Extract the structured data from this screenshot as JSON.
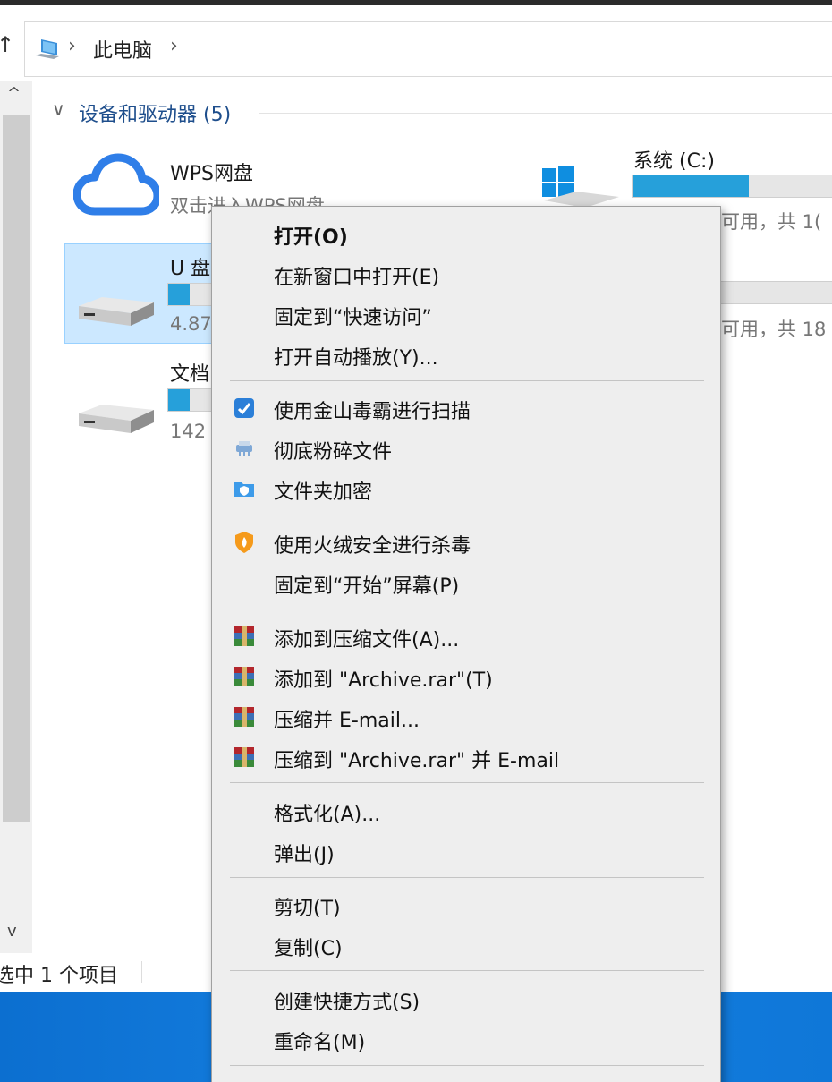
{
  "address": {
    "segment": "此电脑"
  },
  "group": {
    "title": "设备和驱动器 (5)"
  },
  "drives": [
    {
      "name": "WPS网盘",
      "sub": "双击进入WPS网盘",
      "fill": 0
    },
    {
      "name": "系统 (C:)",
      "sub": "可用，共 1(",
      "fill": 0.54
    },
    {
      "name": "U 盘",
      "sub": "4.87",
      "fill": 0.27
    },
    {
      "name": "",
      "sub": "可用，共 18",
      "fill": 0.3
    },
    {
      "name": "文档",
      "sub": "142",
      "fill": 0.27
    }
  ],
  "status": {
    "text": "选中 1 个项目"
  },
  "menu": {
    "items": [
      {
        "label": "打开(O)"
      },
      {
        "label": "在新窗口中打开(E)"
      },
      {
        "label": "固定到“快速访问”"
      },
      {
        "label": "打开自动播放(Y)..."
      },
      {
        "label": "使用金山毒霸进行扫描"
      },
      {
        "label": "彻底粉碎文件"
      },
      {
        "label": "文件夹加密"
      },
      {
        "label": "使用火绒安全进行杀毒"
      },
      {
        "label": "固定到“开始”屏幕(P)"
      },
      {
        "label": "添加到压缩文件(A)..."
      },
      {
        "label": "添加到 \"Archive.rar\"(T)"
      },
      {
        "label": "压缩并 E-mail..."
      },
      {
        "label": "压缩到 \"Archive.rar\" 并 E-mail"
      },
      {
        "label": "格式化(A)..."
      },
      {
        "label": "弹出(J)"
      },
      {
        "label": "剪切(T)"
      },
      {
        "label": "复制(C)"
      },
      {
        "label": "创建快捷方式(S)"
      },
      {
        "label": "重命名(M)"
      }
    ]
  },
  "colors": {
    "accent": "#26a0da",
    "selection": "#cce8ff",
    "taskbar": "#1681e2"
  },
  "icons": [
    "pc-icon",
    "cloud-icon",
    "windows-logo-icon",
    "drive-icon",
    "duba-icon",
    "shredder-icon",
    "folder-lock-icon",
    "huorong-icon",
    "winrar-icon"
  ]
}
